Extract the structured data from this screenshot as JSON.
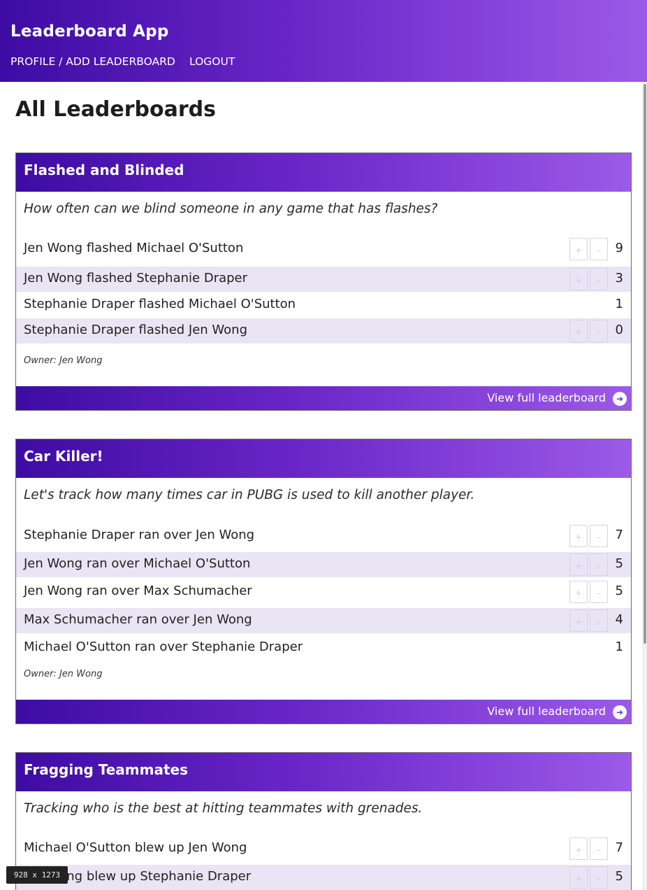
{
  "nav": {
    "brand": "Leaderboard App",
    "profile_link": "PROFILE / ADD LEADERBOARD",
    "logout_link": "LOGOUT"
  },
  "page": {
    "title": "All Leaderboards"
  },
  "leaderboards": [
    {
      "title": "Flashed and Blinded",
      "description": "How often can we blind someone in any game that has flashes?",
      "entries": [
        {
          "text": "Jen Wong flashed Michael O'Sutton",
          "score": "9",
          "plus": "+",
          "minus": "–"
        },
        {
          "text": "Jen Wong flashed Stephanie Draper",
          "score": "3",
          "plus": "+",
          "minus": "–"
        },
        {
          "text": "Stephanie Draper flashed Michael O'Sutton",
          "score": "1"
        },
        {
          "text": "Stephanie Draper flashed Jen Wong",
          "score": "0",
          "plus": "+",
          "minus": "–"
        }
      ],
      "owner": "Owner: Jen Wong",
      "view_link": "View full leaderboard"
    },
    {
      "title": "Car Killer!",
      "description": "Let's track how many times car in PUBG is used to kill another player.",
      "entries": [
        {
          "text": "Stephanie Draper ran over Jen Wong",
          "score": "7",
          "plus": "+",
          "minus": "–"
        },
        {
          "text": "Jen Wong ran over Michael O'Sutton",
          "score": "5",
          "plus": "+",
          "minus": "–"
        },
        {
          "text": "Jen Wong ran over Max Schumacher",
          "score": "5",
          "plus": "+",
          "minus": "–"
        },
        {
          "text": "Max Schumacher ran over Jen Wong",
          "score": "4",
          "plus": "+",
          "minus": "–"
        },
        {
          "text": "Michael O'Sutton ran over Stephanie Draper",
          "score": "1"
        }
      ],
      "owner": "Owner: Jen Wong",
      "view_link": "View full leaderboard"
    },
    {
      "title": "Fragging Teammates",
      "description": "Tracking who is the best at hitting teammates with grenades.",
      "entries": [
        {
          "text": "Michael O'Sutton blew up Jen Wong",
          "score": "7",
          "plus": "+",
          "minus": "–"
        },
        {
          "text": "Jen Wong blew up Stephanie Draper",
          "score": "5",
          "plus": "+",
          "minus": "–"
        }
      ]
    }
  ],
  "icons": {
    "view_arrow": "arrow-right-circle-icon"
  },
  "colors": {
    "gradient_start": "#3d0ca3",
    "gradient_end": "#9c5ae8",
    "row_shade": "#e9e5f4"
  },
  "overlay": {
    "size_badge": "928 x 1273"
  }
}
